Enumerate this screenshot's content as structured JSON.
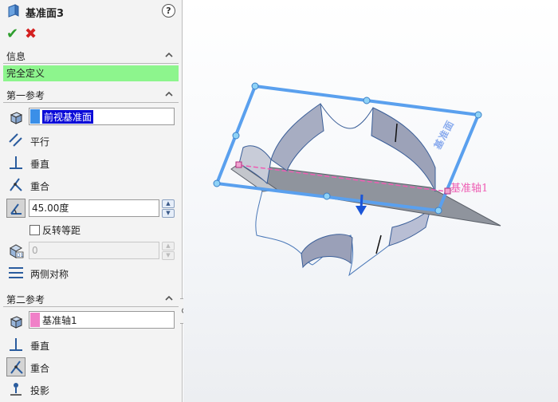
{
  "header": {
    "title": "基准面3",
    "help_glyph": "?"
  },
  "actions": {
    "ok_glyph": "✔",
    "cancel_glyph": "✖"
  },
  "info": {
    "section_label": "信息",
    "status_text": "完全定义",
    "status_color": "#8df58d"
  },
  "first_ref": {
    "section_label": "第一参考",
    "selection": "前视基准面",
    "selection_color": "#3a8fe8",
    "constraints": {
      "parallel": "平行",
      "perpendicular": "垂直",
      "coincident": "重合"
    },
    "angle_value": "45.00度",
    "flip_label": "反转等距",
    "flip_checked": false,
    "distance_value": "0",
    "mid_plane_label": "两侧对称"
  },
  "second_ref": {
    "section_label": "第二参考",
    "selection": "基准轴1",
    "selection_color": "#f080c8",
    "constraints": {
      "perpendicular": "垂直",
      "coincident": "重合",
      "projection": "投影"
    }
  },
  "viewport": {
    "axis_label": "基准轴1",
    "plane_label": "基准面",
    "accent_color": "#5aa0ee"
  }
}
